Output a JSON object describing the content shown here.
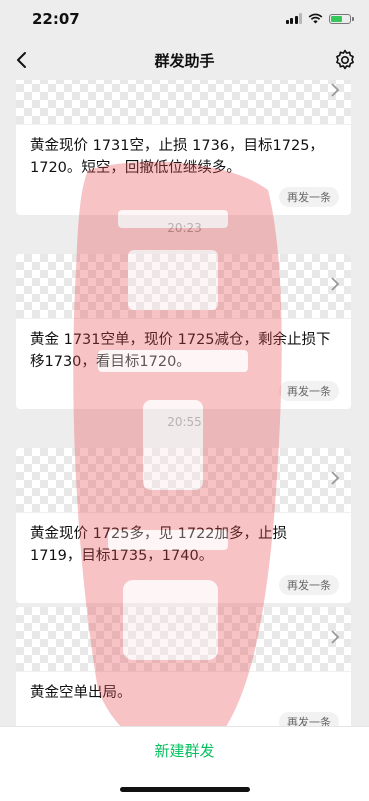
{
  "status_bar": {
    "time": "22:07",
    "battery_level": 0.6
  },
  "nav": {
    "title": "群发助手"
  },
  "messages": [
    {
      "text": "黄金现价 1731空，止损 1736，目标1725，1720。短空，回撤低位继续多。",
      "resend": "再发一条"
    },
    {
      "time": "20:23",
      "text": "黄金 1731空单，现价 1725减仓，剩余止损下移1730，看目标1720。",
      "resend": "再发一条"
    },
    {
      "time": "20:55",
      "text": "黄金现价 1725多，见 1722加多，止损1719，目标1735，1740。",
      "resend": "再发一条"
    },
    {
      "text": "黄金空单出局。",
      "resend": "再发一条"
    }
  ],
  "bottom": {
    "new_group": "新建群发"
  },
  "colors": {
    "accent": "#07c160",
    "background": "#ededed",
    "watermark": "#e8494f"
  }
}
